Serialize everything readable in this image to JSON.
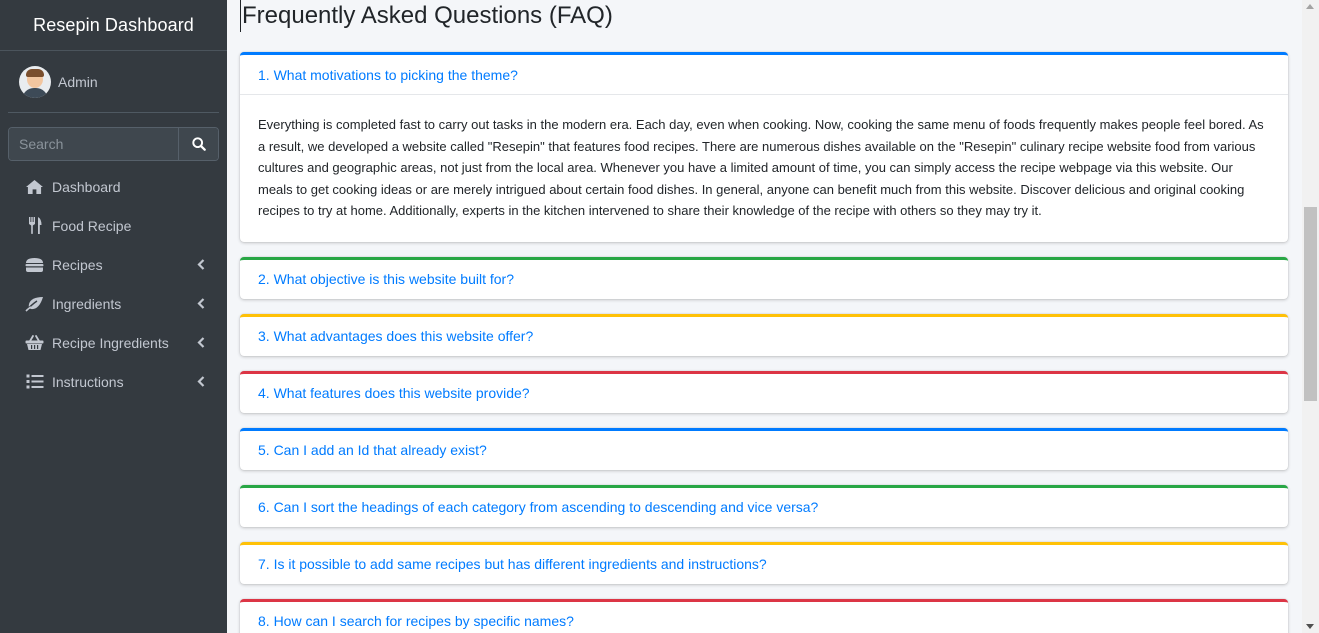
{
  "sidebar": {
    "brand": "Resepin Dashboard",
    "user": {
      "name": "Admin"
    },
    "search": {
      "placeholder": "Search",
      "value": ""
    },
    "nav": [
      {
        "label": "Dashboard",
        "icon": "home-icon",
        "has_children": false
      },
      {
        "label": "Food Recipe",
        "icon": "utensils-icon",
        "has_children": false
      },
      {
        "label": "Recipes",
        "icon": "hamburger-icon",
        "has_children": true
      },
      {
        "label": "Ingredients",
        "icon": "leaf-icon",
        "has_children": true
      },
      {
        "label": "Recipe Ingredients",
        "icon": "basket-icon",
        "has_children": true
      },
      {
        "label": "Instructions",
        "icon": "list-icon",
        "has_children": true
      }
    ]
  },
  "main": {
    "title": "Frequently Asked Questions (FAQ)",
    "faqs": [
      {
        "question": "1. What motivations to picking the theme?",
        "color": "primary",
        "expanded": true,
        "answer": "Everything is completed fast to carry out tasks in the modern era. Each day, even when cooking. Now, cooking the same menu of foods frequently makes people feel bored. As a result, we developed a website called \"Resepin\" that features food recipes. There are numerous dishes available on the \"Resepin\" culinary recipe website food from various cultures and geographic areas, not just from the local area. Whenever you have a limited amount of time, you can simply access the recipe webpage via this website. Our meals to get cooking ideas or are merely intrigued about certain food dishes. In general, anyone can benefit much from this website. Discover delicious and original cooking recipes to try at home. Additionally, experts in the kitchen intervened to share their knowledge of the recipe with others so they may try it."
      },
      {
        "question": "2. What objective is this website built for?",
        "color": "success",
        "expanded": false
      },
      {
        "question": "3. What advantages does this website offer?",
        "color": "warning",
        "expanded": false
      },
      {
        "question": "4. What features does this website provide?",
        "color": "danger",
        "expanded": false
      },
      {
        "question": "5. Can I add an Id that already exist?",
        "color": "primary",
        "expanded": false
      },
      {
        "question": "6. Can I sort the headings of each category from ascending to descending and vice versa?",
        "color": "success",
        "expanded": false
      },
      {
        "question": "7. Is it possible to add same recipes but has different ingredients and instructions?",
        "color": "warning",
        "expanded": false
      },
      {
        "question": "8. How can I search for recipes by specific names?",
        "color": "danger",
        "expanded": false
      }
    ]
  },
  "colors": {
    "sidebar_bg": "#343a40",
    "link": "#007bff",
    "primary": "#007bff",
    "success": "#28a745",
    "warning": "#ffc107",
    "danger": "#dc3545"
  }
}
